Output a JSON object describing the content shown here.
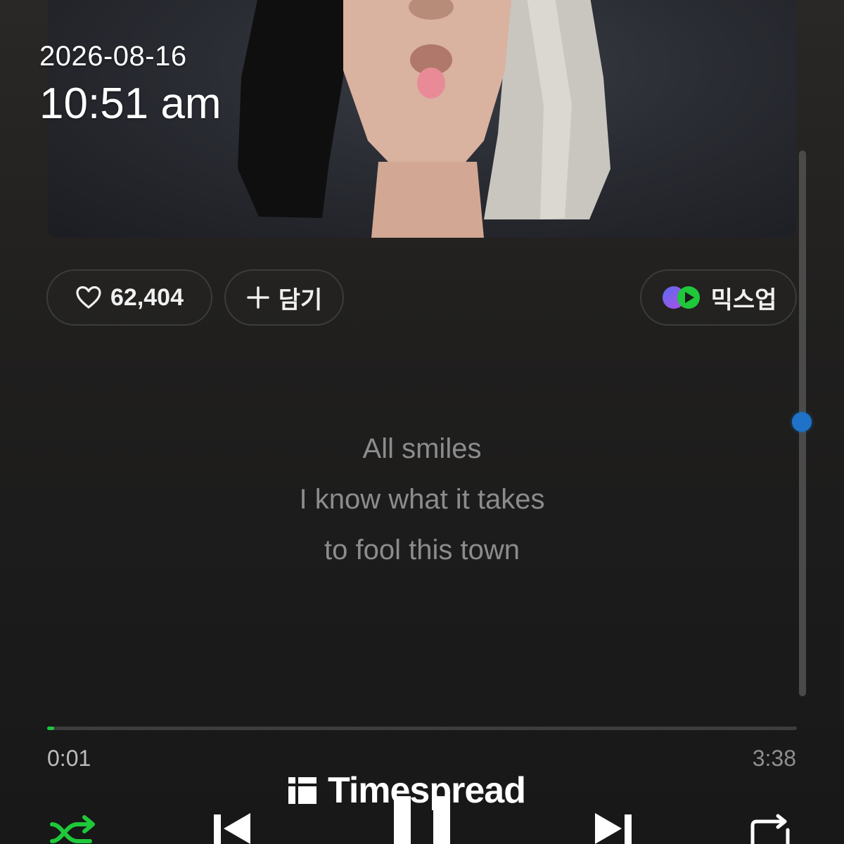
{
  "overlay": {
    "date": "2026-08-16",
    "time": "10:51 am"
  },
  "album": {
    "icon": "album-cover-image"
  },
  "actions": {
    "like_count": "62,404",
    "add_label": "담기",
    "mixup_label": "믹스업"
  },
  "lyrics": [
    "All smiles",
    "I know what it takes",
    "to fool this town"
  ],
  "player": {
    "current_time": "0:01",
    "total_time": "3:38",
    "progress_fraction": 0.005,
    "accent_color": "#1ec83a",
    "controls": [
      "shuffle-icon",
      "previous-icon",
      "pause-icon",
      "next-icon",
      "repeat-icon"
    ]
  },
  "watermark": {
    "text": "Timespread"
  }
}
